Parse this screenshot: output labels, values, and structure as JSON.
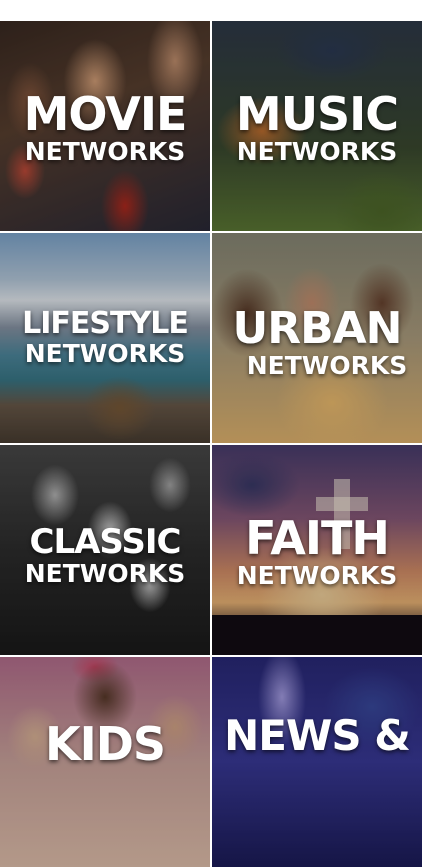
{
  "tiles": [
    {
      "id": "movie",
      "title": "MOVIE",
      "subtitle": "NETWORKS",
      "icon": "movie-audience-photo"
    },
    {
      "id": "music",
      "title": "MUSIC",
      "subtitle": "NETWORKS",
      "icon": "guitar-photo"
    },
    {
      "id": "lifestyle",
      "title": "LIFESTYLE",
      "subtitle": "NETWORKS",
      "icon": "mountain-lake-photo"
    },
    {
      "id": "urban",
      "title": "URBAN",
      "subtitle": "NETWORKS",
      "icon": "family-photo"
    },
    {
      "id": "classic",
      "title": "CLASSIC",
      "subtitle": "NETWORKS",
      "icon": "black-white-film-photo"
    },
    {
      "id": "faith",
      "title": "FAITH",
      "subtitle": "NETWORKS",
      "icon": "cross-sunset-photo"
    },
    {
      "id": "kids",
      "title": "KIDS",
      "subtitle": "",
      "icon": "children-photo"
    },
    {
      "id": "news",
      "title": "NEWS &",
      "subtitle": "",
      "icon": "storm-lightning-photo"
    }
  ],
  "colors": {
    "background": "#ffffff",
    "text": "#ffffff"
  }
}
